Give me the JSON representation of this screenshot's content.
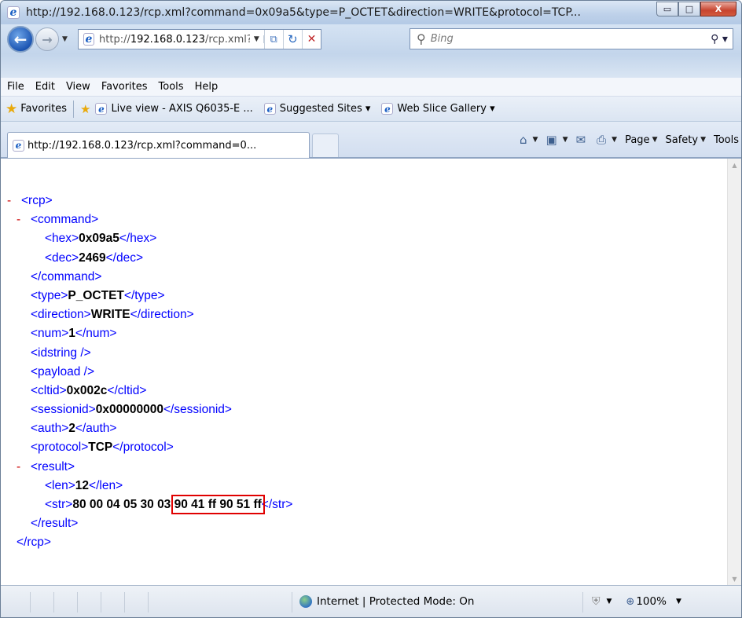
{
  "window": {
    "title": "http://192.168.0.123/rcp.xml?command=0x09a5&type=P_OCTET&direction=WRITE&protocol=TCP...",
    "minimize_glyph": "▭",
    "maximize_glyph": "□",
    "close_glyph": "X"
  },
  "address_bar": {
    "url_prefix": "http://",
    "url_host": "192.168.0.123",
    "url_rest": "/rcp.xml?c",
    "search_placeholder": "Bing"
  },
  "menu": {
    "items": [
      "File",
      "Edit",
      "View",
      "Favorites",
      "Tools",
      "Help"
    ]
  },
  "favorites_bar": {
    "favorites_label": "Favorites",
    "links": [
      "Live view - AXIS Q6035-E ...",
      "Suggested Sites ▾",
      "Web Slice Gallery ▾"
    ]
  },
  "tabs": {
    "active_tab": "http://192.168.0.123/rcp.xml?command=0..."
  },
  "command_bar": {
    "page": "Page",
    "safety": "Safety",
    "tools": "Tools",
    "help": "?"
  },
  "xml": {
    "rcp_open": "<rcp>",
    "rcp_close": "</rcp>",
    "command_open": "<command>",
    "command_close": "</command>",
    "hex_open": "<hex>",
    "hex_value": "0x09a5",
    "hex_close": "</hex>",
    "dec_open": "<dec>",
    "dec_value": "2469",
    "dec_close": "</dec>",
    "type_open": "<type>",
    "type_value": "P_OCTET",
    "type_close": "</type>",
    "direction_open": "<direction>",
    "direction_value": "WRITE",
    "direction_close": "</direction>",
    "num_open": "<num>",
    "num_value": "1",
    "num_close": "</num>",
    "idstring": "<idstring />",
    "payload": "<payload />",
    "cltid_open": "<cltid>",
    "cltid_value": "0x002c",
    "cltid_close": "</cltid>",
    "sessionid_open": "<sessionid>",
    "sessionid_value": "0x00000000",
    "sessionid_close": "</sessionid>",
    "auth_open": "<auth>",
    "auth_value": "2",
    "auth_close": "</auth>",
    "protocol_open": "<protocol>",
    "protocol_value": "TCP",
    "protocol_close": "</protocol>",
    "result_open": "<result>",
    "result_close": "</result>",
    "len_open": "<len>",
    "len_value": "12",
    "len_close": "</len>",
    "str_open": "<str>",
    "str_value_plain": "80 00 04 05 30 03 ",
    "str_value_highlight": "90 41 ff 90 51 ff",
    "str_close": "</str>",
    "collapse_glyph": "-"
  },
  "status_bar": {
    "zone": "Internet | Protected Mode: On",
    "zoom": "100%"
  },
  "colors": {
    "tag": "#0000ff",
    "collapse": "#cc0000",
    "highlight_box": "#e00000"
  }
}
